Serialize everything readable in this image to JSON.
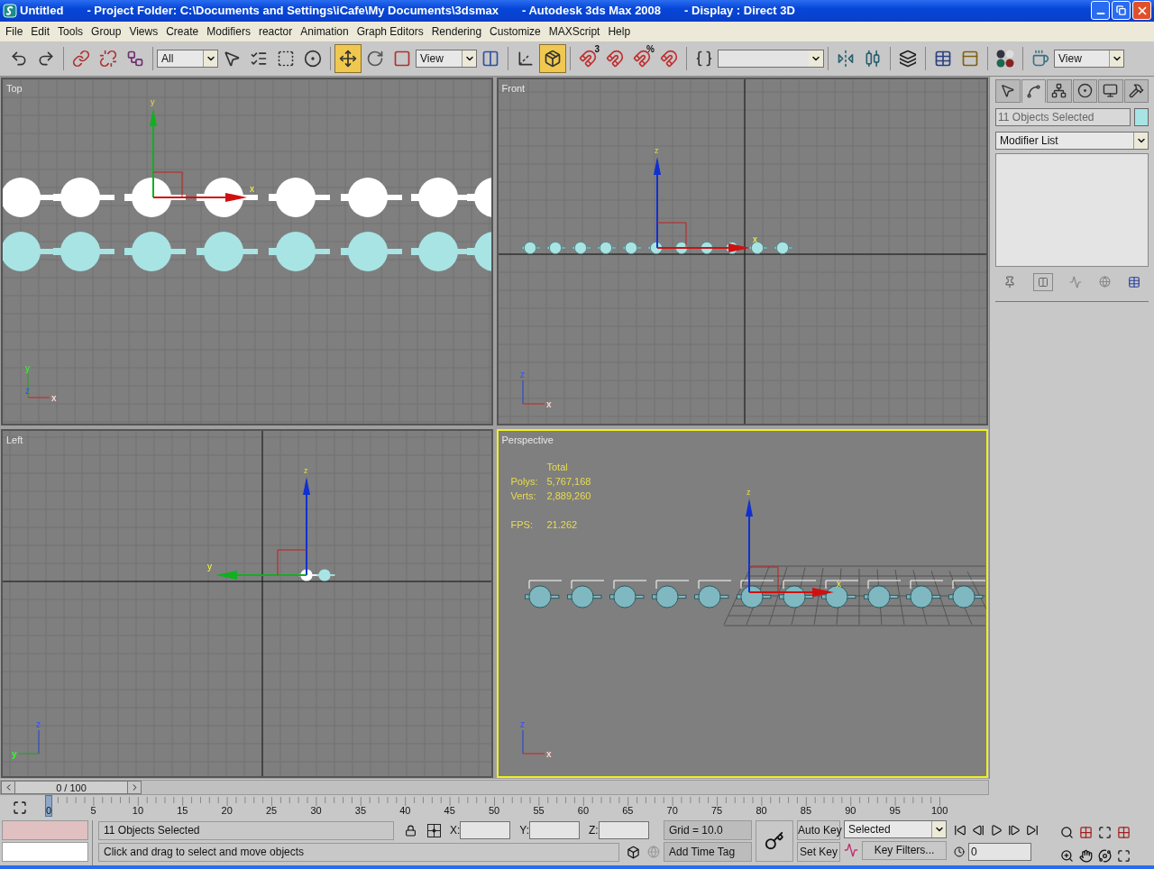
{
  "window": {
    "title": [
      "Untitled",
      "- Project Folder: C:\\Documents and Settings\\iCafe\\My Documents\\3dsmax",
      "- Autodesk 3ds Max 2008",
      "- Display : Direct 3D"
    ]
  },
  "menu": [
    "File",
    "Edit",
    "Tools",
    "Group",
    "Views",
    "Create",
    "Modifiers",
    "reactor",
    "Animation",
    "Graph Editors",
    "Rendering",
    "Customize",
    "MAXScript",
    "Help"
  ],
  "toolbar": {
    "selection_filter": "All",
    "reference_coordinate": "View",
    "render_preset": "View",
    "snap_badge": "3",
    "percent_badge": "%",
    "tools": [
      {
        "selected": false
      },
      {
        "selected": false
      },
      {
        "selected": false
      },
      {
        "selected": false
      },
      {
        "selected": false
      },
      {
        "selected": false
      },
      {
        "selected": false
      },
      {
        "selected": false
      },
      {
        "selected": false
      },
      {
        "selected": true
      },
      {
        "selected": false
      },
      {
        "selected": false
      },
      {
        "selected": false
      },
      {
        "selected": false
      },
      {
        "selected": true
      },
      {
        "selected": false
      },
      {
        "selected": false
      },
      {
        "selected": false
      },
      {
        "selected": false
      },
      {
        "selected": false
      },
      {
        "selected": false
      },
      {
        "selected": false
      },
      {
        "selected": false
      },
      {
        "selected": false
      },
      {
        "selected": false
      },
      {
        "selected": false
      },
      {
        "selected": false
      }
    ]
  },
  "viewports": [
    {
      "kind": "top",
      "label": "Top",
      "active": false,
      "gizmo": {
        "vertical": "y",
        "horizontal": "x"
      },
      "tripod": {
        "vertical": "y",
        "horizontal": "x",
        "depth": "z"
      }
    },
    {
      "kind": "front",
      "label": "Front",
      "active": false,
      "gizmo": {
        "vertical": "z",
        "horizontal": "x"
      },
      "tripod": {
        "vertical": "z",
        "horizontal": "x"
      }
    },
    {
      "kind": "left",
      "label": "Left",
      "active": false,
      "gizmo": {
        "vertical": "z",
        "horizontal": "y"
      },
      "tripod": {
        "vertical": "z",
        "horizontal": "y"
      }
    },
    {
      "kind": "perspective",
      "label": "Perspective",
      "active": true,
      "gizmo": {
        "vertical": "z",
        "horizontal": "x"
      },
      "tripod": {
        "vertical": "z",
        "horizontal": "x"
      },
      "stats": {
        "heading": "Total",
        "rows": [
          {
            "label": "Polys:",
            "value": "5,767,168"
          },
          {
            "label": "Verts:",
            "value": "2,889,260"
          },
          {
            "label": "FPS:",
            "value": "21.262"
          }
        ]
      }
    }
  ],
  "command_panel": {
    "tabs": [
      {
        "selected": false
      },
      {
        "selected": true
      },
      {
        "selected": false
      },
      {
        "selected": false
      },
      {
        "selected": false
      },
      {
        "selected": false
      }
    ],
    "object_name": "11 Objects Selected",
    "modifier_list": "Modifier List"
  },
  "time_slider": {
    "label": "0 / 100",
    "level": 0
  },
  "track_bar": {
    "labels": [
      "0",
      "5",
      "10",
      "15",
      "20",
      "25",
      "30",
      "35",
      "40",
      "45",
      "50",
      "55",
      "60",
      "65",
      "70",
      "75",
      "80",
      "85",
      "90",
      "95",
      "100"
    ]
  },
  "status": {
    "selection": "11 Objects Selected",
    "prompt": "Click and drag to select and move objects",
    "coords": [
      "X:",
      "Y:",
      "Z:"
    ],
    "grid": "Grid = 10.0",
    "time_tag": "Add Time Tag",
    "auto_key": {
      "label": "Auto Key",
      "on": false
    },
    "set_key": "Set Key",
    "key_mode": "Selected",
    "key_filters": "Key Filters...",
    "current_frame": "0"
  }
}
